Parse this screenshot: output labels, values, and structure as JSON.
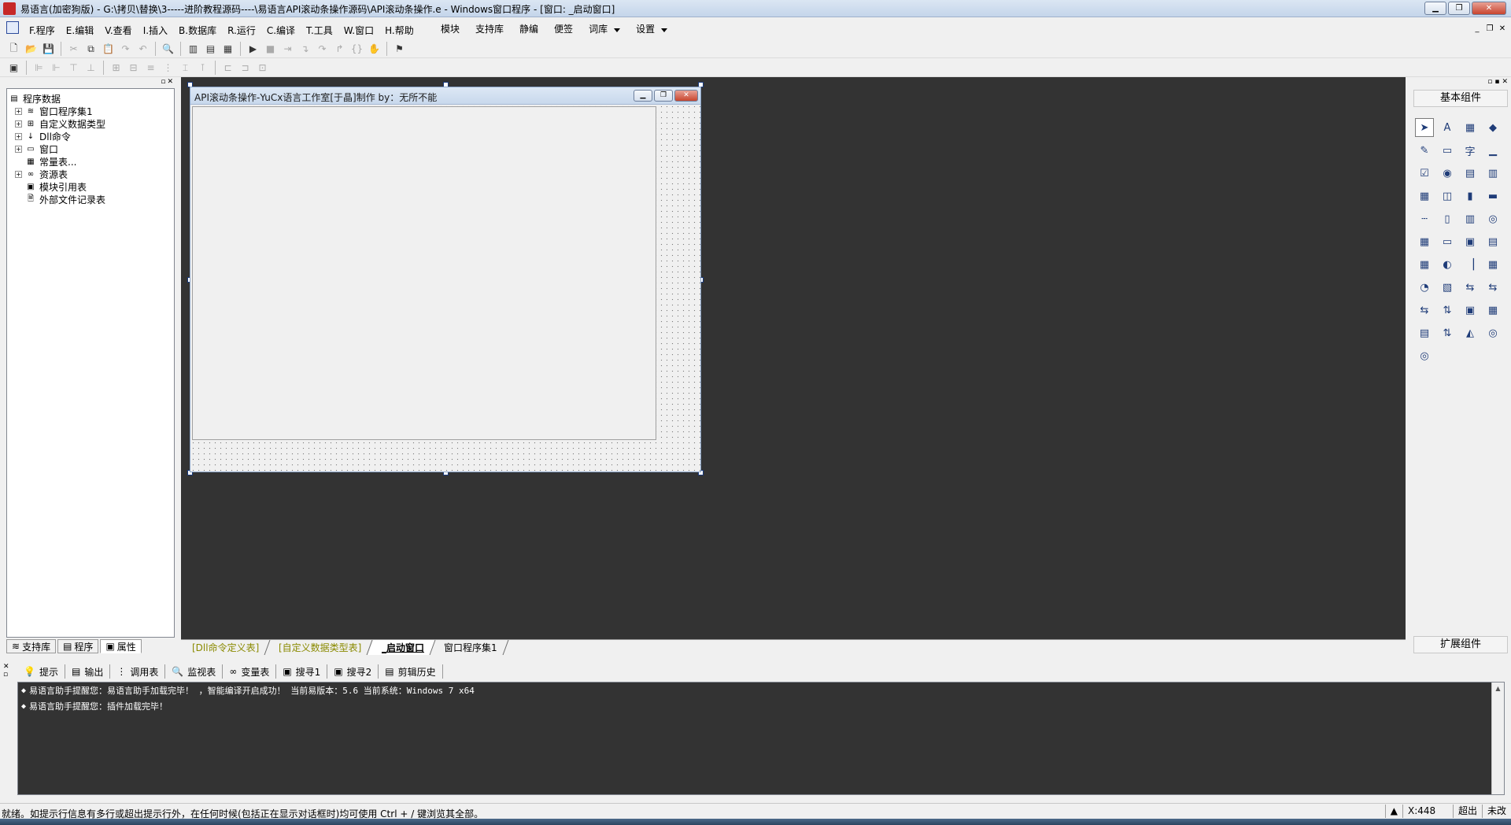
{
  "window": {
    "title": "易语言(加密狗版) - G:\\拷贝\\替换\\3-----进阶教程源码----\\易语言API滚动条操作源码\\API滚动条操作.e - Windows窗口程序 - [窗口: _启动窗口]",
    "min_glyph": "▁",
    "max_glyph": "❐",
    "close_glyph": "✕"
  },
  "menubar": {
    "items": [
      "F.程序",
      "E.编辑",
      "V.查看",
      "I.插入",
      "B.数据库",
      "R.运行",
      "C.编译",
      "T.工具",
      "W.窗口",
      "H.帮助"
    ],
    "right_items": [
      "模块",
      "支持库",
      "静编",
      "便签",
      "词库",
      "设置"
    ],
    "mdi_min": "_",
    "mdi_restore": "❐",
    "mdi_close": "✕"
  },
  "left_panel": {
    "tree_root": "程序数据",
    "nodes": [
      {
        "label": "窗口程序集1",
        "icon": "stack-icon",
        "expand": "+"
      },
      {
        "label": "自定义数据类型",
        "icon": "struct-icon",
        "expand": "+"
      },
      {
        "label": "Dll命令",
        "icon": "dll-icon",
        "expand": "+"
      },
      {
        "label": "窗口",
        "icon": "window-icon",
        "expand": "+"
      },
      {
        "label": "常量表...",
        "icon": "constant-icon",
        "expand": ""
      },
      {
        "label": "资源表",
        "icon": "resource-icon",
        "expand": "+"
      },
      {
        "label": "模块引用表",
        "icon": "module-icon",
        "expand": ""
      },
      {
        "label": "外部文件记录表",
        "icon": "file-icon",
        "expand": ""
      }
    ],
    "tabs": [
      "支持库",
      "程序",
      "属性"
    ]
  },
  "design": {
    "form_title": "API滚动条操作-YuCx语言工作室[于晶]制作 by：无所不能"
  },
  "doc_tabs": [
    "[Dll命令定义表]",
    "[自定义数据类型表]",
    "_启动窗口",
    "窗口程序集1"
  ],
  "right_panel": {
    "basic_label": "基本组件",
    "ext_label": "扩展组件",
    "palette": [
      "➤",
      "A",
      "▦",
      "◆",
      "✎",
      "▭",
      "字",
      "▁",
      "☑",
      "◉",
      "▤",
      "▥",
      "▦",
      "◫",
      "▮",
      "▬",
      "┄",
      "▯",
      "▥",
      "◎",
      "▦",
      "▭",
      "▣",
      "▤",
      "▦",
      "◐",
      "▕",
      "▦",
      "◔",
      "▧",
      "⇆",
      "⇆",
      "⇆",
      "⇅",
      "▣",
      "▦",
      "▤",
      "⇅",
      "◭",
      "◎",
      "◎"
    ]
  },
  "output": {
    "tabs": [
      "提示",
      "输出",
      "调用表",
      "监视表",
      "变量表",
      "搜寻1",
      "搜寻2",
      "剪辑历史"
    ],
    "lines": [
      "易语言助手提醒您：易语言助手加载完毕！ ，智能编译开启成功！ 当前易版本：5.6 当前系统：Windows 7 x64",
      "易语言助手提醒您：插件加载完毕！"
    ]
  },
  "status": {
    "text": "就绪。如提示行信息有多行或超出提示行外，在任何时候(包括正在显示对话框时)均可使用 Ctrl + / 键浏览其全部。",
    "coord": "X:448",
    "mode": "超出",
    "state": "未改"
  }
}
